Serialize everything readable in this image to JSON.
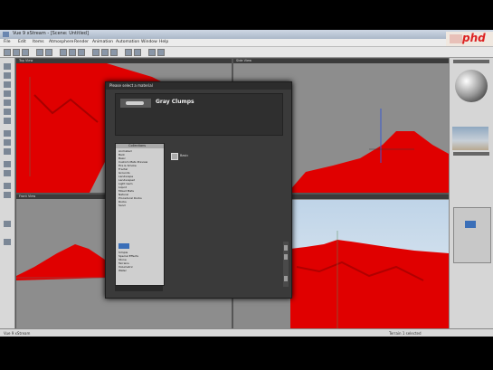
{
  "window": {
    "title": "Vue 9 xStream - [Scene: Untitled]",
    "logo_text": "phd"
  },
  "menu": [
    "File",
    "Edit",
    "Items",
    "Atmosphere",
    "Render",
    "Animation",
    "Automation",
    "Window",
    "Help"
  ],
  "viewports": {
    "top_left": "Top View",
    "top_right": "Side View",
    "bottom_left": "Front View",
    "bottom_right": "Main camera"
  },
  "dialog": {
    "title": "Please select a material",
    "selected_name": "Gray Clumps",
    "tree_header": "Collections",
    "tree_items": [
      "Animated",
      "Bark",
      "Basic",
      "Custom Mats Preview",
      "Fire & Smoke",
      "Fractal",
      "Grounds",
      "Landscape",
      "Landscape2",
      "Light Gem",
      "Liquid",
      "Mixed Mats",
      "Natural",
      "Procedural Rocks",
      "Rocks",
      "Sand",
      "Simple",
      "Special Effects",
      "Stone",
      "Terrains",
      "Volumetric",
      "Water"
    ],
    "entry_label": "Basic"
  },
  "status": {
    "left": "Vue 9 xStream",
    "right": "Terrain 1 selected"
  },
  "colors": {
    "terrain": "#e00000",
    "viewport_bg": "#8d8d8d",
    "dialog_bg": "#3a3a3a"
  }
}
